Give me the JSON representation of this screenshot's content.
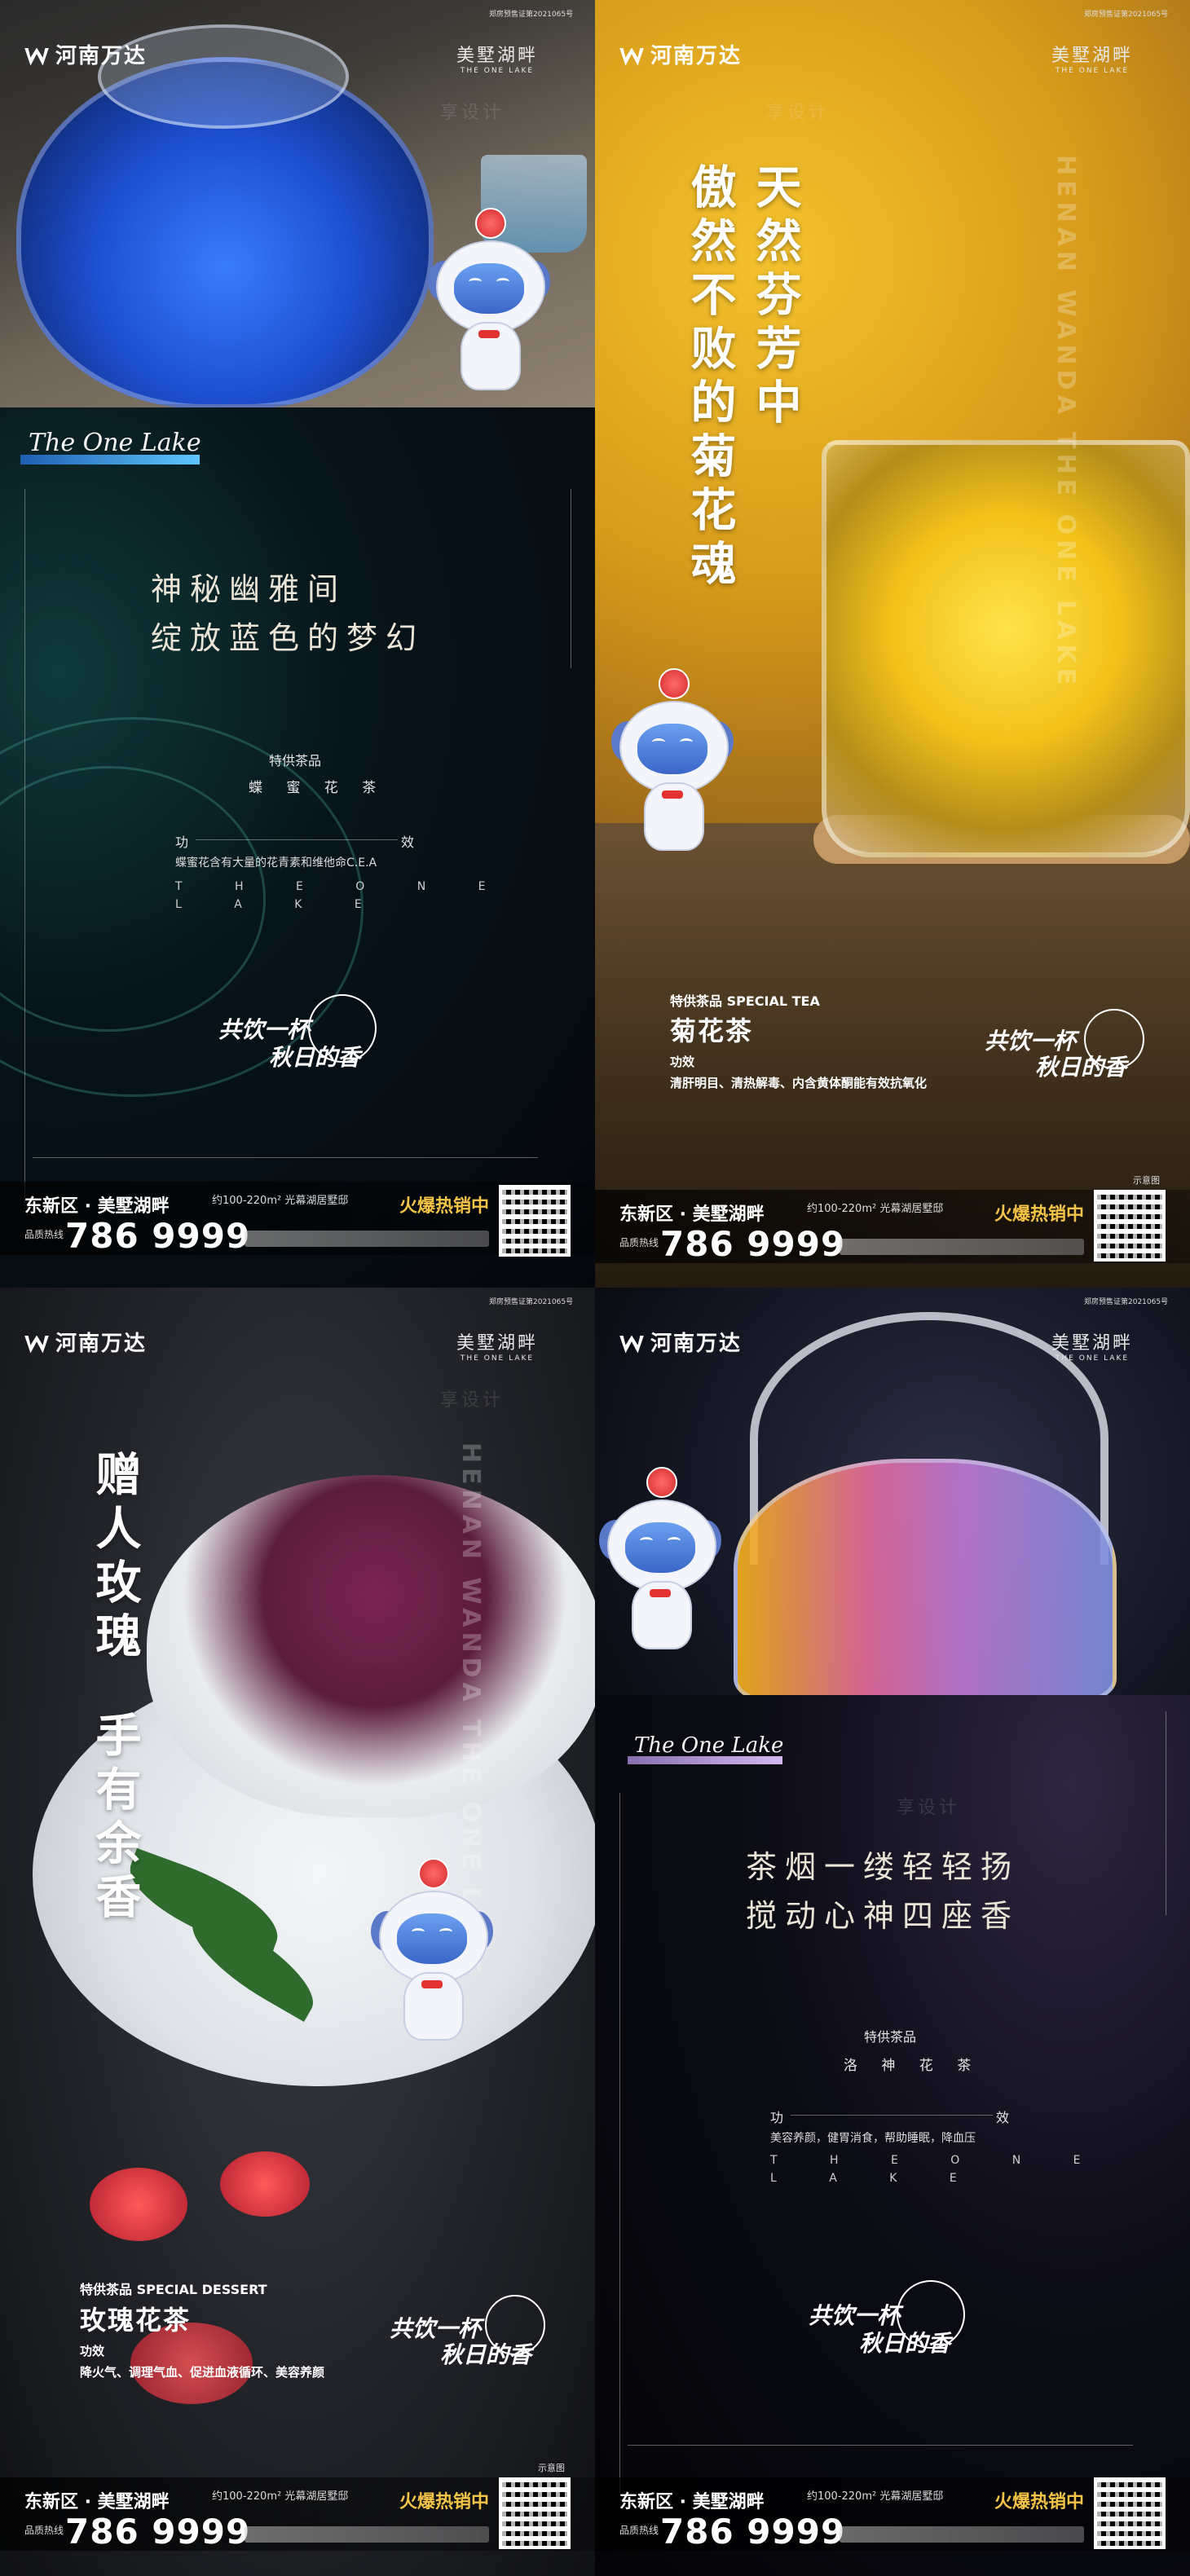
{
  "brand": {
    "logo": "河南万达",
    "project_name": "美墅湖畔",
    "project_en": "THE ONE LAKE",
    "vertical_en": "HENAN WANDA THE ONE LAKE",
    "permit": "郑房预售证第2021065号"
  },
  "watermark": "享设计",
  "script_logo": "The One Lake",
  "panel1": {
    "headline_line1": "神秘幽雅间",
    "headline_line2": "绽放蓝色的梦幻",
    "special_label": "特供茶品",
    "tea_name": "蝶 蜜 花 茶",
    "effect_left": "功",
    "effect_right": "效",
    "effect_desc": "蝶蜜花含有大量的花青素和维他命C.E.A",
    "letters_row1": "T H E O N E",
    "letters_row2": "L A K E",
    "slogan_line1": "共饮一杯",
    "slogan_line2": "秋日的香"
  },
  "panel2": {
    "vertical_line1": "天然芬芳中",
    "vertical_line2": "傲然不败的菊花魂",
    "special_label": "特供茶品 SPECIAL TEA",
    "tea_name": "菊花茶",
    "effect_label": "功效",
    "effect_text": "清肝明目、清热解毒、内含黄体酮能有效抗氧化",
    "slogan_line1": "共饮一杯",
    "slogan_line2": "秋日的香",
    "sample": "示意图"
  },
  "panel3": {
    "vertical_line1": "赠人玫瑰",
    "vertical_line2": "手有余香",
    "special_label": "特供茶品 SPECIAL DESSERT",
    "tea_name": "玫瑰花茶",
    "effect_label": "功效",
    "effect_text": "降火气、调理气血、促进血液循环、美容养颜",
    "slogan_line1": "共饮一杯",
    "slogan_line2": "秋日的香",
    "sample": "示意图"
  },
  "panel4": {
    "headline_line1": "茶烟一缕轻轻扬",
    "headline_line2": "搅动心神四座香",
    "special_label": "特供茶品",
    "tea_name": "洛 神 花 茶",
    "effect_left": "功",
    "effect_right": "效",
    "effect_desc": "美容养颜，健胃消食，帮助睡眠，降血压",
    "letters_row1": "T H E O N E",
    "letters_row2": "L A K E",
    "slogan_line1": "共饮一杯",
    "slogan_line2": "秋日的香"
  },
  "footer": {
    "address": "东新区 · 美墅湖畔",
    "area": "约100-220m² 光幕湖居墅邸",
    "hot": "火爆热销中",
    "phone_prefix": "品质热线",
    "phone": "786 9999"
  }
}
